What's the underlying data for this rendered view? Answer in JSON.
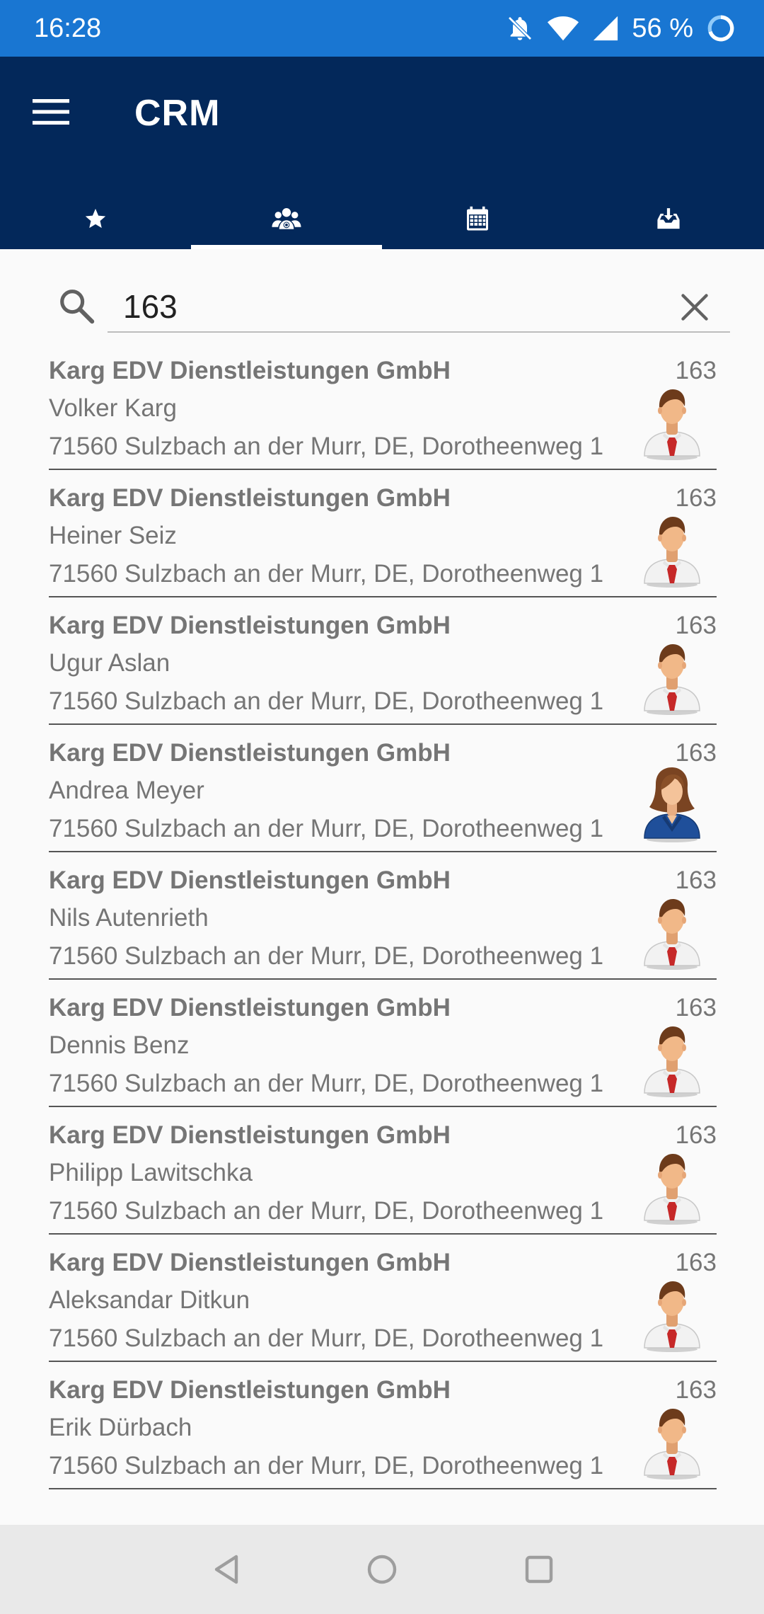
{
  "status_bar": {
    "time": "16:28",
    "battery": "56 %",
    "icons": [
      "bell-off-icon",
      "wifi-icon",
      "signal-icon",
      "battery-ring-icon"
    ]
  },
  "app_bar": {
    "title": "CRM",
    "menu_icon": "hamburger-menu-icon",
    "background": "#03285a",
    "tabs": [
      {
        "icon": "star-icon",
        "active": false
      },
      {
        "icon": "contacts-group-icon",
        "active": true
      },
      {
        "icon": "calendar-icon",
        "active": false
      },
      {
        "icon": "inbox-download-icon",
        "active": false
      }
    ]
  },
  "search": {
    "value": "163",
    "icon": "search-icon",
    "clear_icon": "close-icon"
  },
  "contacts": [
    {
      "company": "Karg EDV Dienstleistungen GmbH",
      "number": "163",
      "name": "Volker Karg",
      "address": "71560 Sulzbach an der Murr, DE, Dorotheenweg 1",
      "avatar": "male"
    },
    {
      "company": "Karg EDV Dienstleistungen GmbH",
      "number": "163",
      "name": "Heiner Seiz",
      "address": "71560 Sulzbach an der Murr, DE, Dorotheenweg 1",
      "avatar": "male"
    },
    {
      "company": "Karg EDV Dienstleistungen GmbH",
      "number": "163",
      "name": "Ugur Aslan",
      "address": "71560 Sulzbach an der Murr, DE, Dorotheenweg 1",
      "avatar": "male"
    },
    {
      "company": "Karg EDV Dienstleistungen GmbH",
      "number": "163",
      "name": "Andrea Meyer",
      "address": "71560 Sulzbach an der Murr, DE, Dorotheenweg 1",
      "avatar": "female"
    },
    {
      "company": "Karg EDV Dienstleistungen GmbH",
      "number": "163",
      "name": "Nils Autenrieth",
      "address": "71560 Sulzbach an der Murr, DE, Dorotheenweg 1",
      "avatar": "male"
    },
    {
      "company": "Karg EDV Dienstleistungen GmbH",
      "number": "163",
      "name": "Dennis Benz",
      "address": "71560 Sulzbach an der Murr, DE, Dorotheenweg 1",
      "avatar": "male"
    },
    {
      "company": "Karg EDV Dienstleistungen GmbH",
      "number": "163",
      "name": "Philipp Lawitschka",
      "address": "71560 Sulzbach an der Murr, DE, Dorotheenweg 1",
      "avatar": "male"
    },
    {
      "company": "Karg EDV Dienstleistungen GmbH",
      "number": "163",
      "name": "Aleksandar Ditkun",
      "address": "71560 Sulzbach an der Murr, DE, Dorotheenweg 1",
      "avatar": "male"
    },
    {
      "company": "Karg EDV Dienstleistungen GmbH",
      "number": "163",
      "name": "Erik Dürbach",
      "address": "71560 Sulzbach an der Murr, DE, Dorotheenweg 1",
      "avatar": "male"
    }
  ],
  "nav_bar": {
    "icons": [
      "back-icon",
      "home-icon",
      "recents-icon"
    ]
  }
}
